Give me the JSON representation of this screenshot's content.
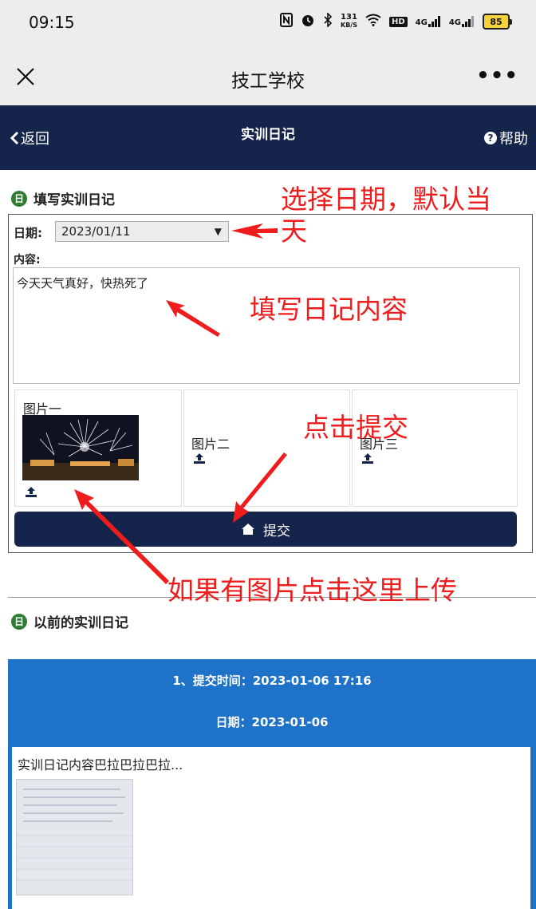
{
  "status_bar": {
    "time": "09:15",
    "net_speed_top": "131",
    "net_speed_bottom": "KB/S",
    "hd_label": "HD",
    "signal_1_label": "4G",
    "signal_2_label": "4G",
    "battery": "85"
  },
  "wechat_bar": {
    "title": "技工学校",
    "more_label": "•••"
  },
  "header": {
    "back_label": "返回",
    "title": "实训日记",
    "help_label": "帮助"
  },
  "form": {
    "section_title": "填写实训日记",
    "date_label": "日期:",
    "date_value": "2023/01/11",
    "content_label": "内容:",
    "content_value": "今天天气真好，快热死了",
    "images": [
      {
        "label": "图片一"
      },
      {
        "label": "图片二"
      },
      {
        "label": "图片三"
      }
    ],
    "submit_label": "提交"
  },
  "history": {
    "section_title": "以前的实训日记",
    "records": [
      {
        "submitted_line": "1、提交时间：2023-01-06 17:16",
        "date_line": "日期：2023-01-06",
        "content": "实训日记内容巴拉巴拉巴拉..."
      }
    ]
  },
  "annotations": {
    "date_note": "选择日期，默认当\n天",
    "content_note": "填写日记内容",
    "submit_note": "点击提交",
    "upload_note": "如果有图片点击这里上传"
  },
  "colors": {
    "navy": "#15244a",
    "record_blue": "#1e72c8",
    "annotation_red": "#ee1c1c",
    "section_icon_green": "#2e7d32"
  }
}
